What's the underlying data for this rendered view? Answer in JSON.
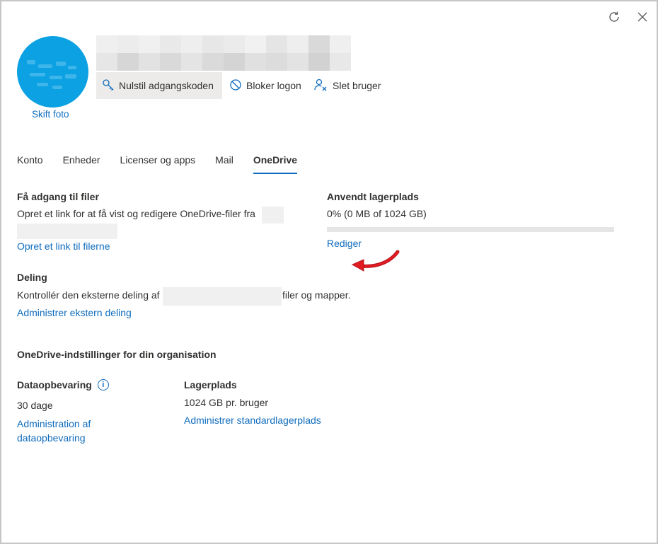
{
  "header": {
    "refresh_icon": "refresh-icon",
    "close_icon": "close-icon",
    "change_photo": "Skift foto"
  },
  "commands": {
    "reset_password": "Nulstil adgangskoden",
    "block_signin": "Bloker logon",
    "delete_user": "Slet bruger"
  },
  "tabs": [
    {
      "label": "Konto"
    },
    {
      "label": "Enheder"
    },
    {
      "label": "Licenser og apps"
    },
    {
      "label": "Mail"
    },
    {
      "label": "OneDrive"
    }
  ],
  "files": {
    "heading": "Få adgang til filer",
    "text": "Opret et link for at få vist og redigere OneDrive-filer fra",
    "link": "Opret et link til filerne"
  },
  "storage": {
    "heading": "Anvendt lagerplads",
    "usage": "0% (0 MB of 1024 GB)",
    "usage_fraction": 0,
    "edit_link": "Rediger"
  },
  "sharing": {
    "heading": "Deling",
    "text_before": "Kontrollér den eksterne deling af",
    "text_after": "filer og mapper.",
    "link": "Administrer ekstern deling"
  },
  "org_settings": {
    "heading": "OneDrive-indstillinger for din organisation",
    "retention": {
      "heading": "Dataopbevaring",
      "value": "30 dage",
      "link_line1": "Administration af",
      "link_line2": "dataopbevaring"
    },
    "storage": {
      "heading": "Lagerplads",
      "value": "1024 GB pr. bruger",
      "link": "Administrer standardlagerplads"
    }
  },
  "colors": {
    "accent": "#0f6cbd",
    "avatar": "#0ba1e2",
    "annotation_arrow": "#e11b22"
  }
}
